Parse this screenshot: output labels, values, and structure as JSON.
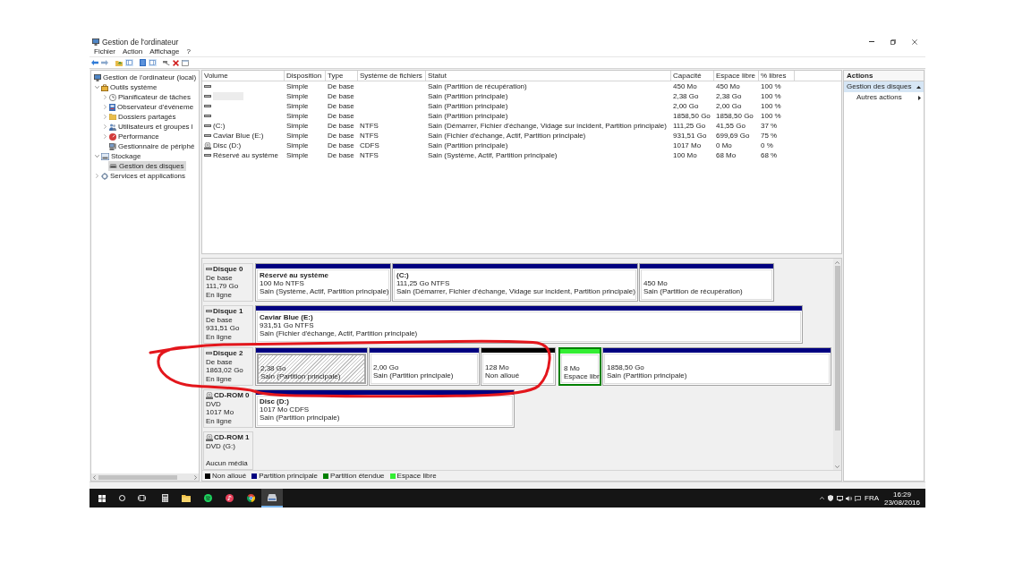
{
  "window": {
    "title": "Gestion de l'ordinateur"
  },
  "menu": [
    "Fichier",
    "Action",
    "Affichage",
    "?"
  ],
  "tree": [
    {
      "label": "Gestion de l'ordinateur (local)",
      "kind": "computer",
      "selected": false,
      "children": [
        {
          "label": "Outils système",
          "kind": "tools",
          "expanded": true,
          "selected": false,
          "children": [
            {
              "label": "Planificateur de tâches",
              "kind": "clock",
              "expanded": false,
              "selected": false
            },
            {
              "label": "Observateur d'événeme",
              "kind": "viewer",
              "expanded": false,
              "selected": false
            },
            {
              "label": "Dossiers partagés",
              "kind": "folder",
              "expanded": false,
              "selected": false
            },
            {
              "label": "Utilisateurs et groupes l",
              "kind": "users",
              "expanded": false,
              "selected": false
            },
            {
              "label": "Performance",
              "kind": "performance",
              "expanded": false,
              "selected": false
            },
            {
              "label": "Gestionnaire de périphé",
              "kind": "devices",
              "selected": false
            }
          ]
        },
        {
          "label": "Stockage",
          "kind": "storage",
          "expanded": true,
          "selected": false,
          "children": [
            {
              "label": "Gestion des disques",
              "kind": "disks",
              "selected": true
            }
          ]
        },
        {
          "label": "Services et applications",
          "kind": "services",
          "expanded": false,
          "selected": false
        }
      ]
    }
  ],
  "volumes": {
    "columns": [
      "Volume",
      "Disposition",
      "Type",
      "Système de fichiers",
      "Statut",
      "Capacité",
      "Espace libre",
      "% libres"
    ],
    "rows": [
      {
        "kind": "disk",
        "redacted": false,
        "layout": "Simple",
        "type": "De base",
        "status": "Sain (Partition de récupération)",
        "capacity": "450 Mo",
        "free": "450 Mo",
        "percent_free": "100 %"
      },
      {
        "kind": "disk",
        "redacted": true,
        "layout": "Simple",
        "type": "De base",
        "status": "Sain (Partition principale)",
        "capacity": "2,38 Go",
        "free": "2,38 Go",
        "percent_free": "100 %"
      },
      {
        "kind": "disk",
        "redacted": false,
        "layout": "Simple",
        "type": "De base",
        "status": "Sain (Partition principale)",
        "capacity": "2,00 Go",
        "free": "2,00 Go",
        "percent_free": "100 %"
      },
      {
        "kind": "disk",
        "redacted": false,
        "layout": "Simple",
        "type": "De base",
        "status": "Sain (Partition principale)",
        "capacity": "1858,50 Go",
        "free": "1858,50 Go",
        "percent_free": "100 %"
      },
      {
        "kind": "disk",
        "redacted": false,
        "volume": "(C:)",
        "layout": "Simple",
        "type": "De base",
        "filesystem": "NTFS",
        "status": "Sain (Démarrer, Fichier d'échange, Vidage sur incident, Partition principale)",
        "capacity": "111,25 Go",
        "free": "41,55 Go",
        "percent_free": "37 %"
      },
      {
        "kind": "disk",
        "redacted": false,
        "volume": "Caviar Blue (E:)",
        "layout": "Simple",
        "type": "De base",
        "filesystem": "NTFS",
        "status": "Sain (Fichier d'échange, Actif, Partition principale)",
        "capacity": "931,51 Go",
        "free": "699,69 Go",
        "percent_free": "75 %"
      },
      {
        "kind": "cd",
        "redacted": false,
        "volume": "Disc (D:)",
        "layout": "Simple",
        "type": "De base",
        "filesystem": "CDFS",
        "status": "Sain (Partition principale)",
        "capacity": "1017 Mo",
        "free": "0 Mo",
        "percent_free": "0 %"
      },
      {
        "kind": "disk",
        "redacted": false,
        "volume": "Réservé au système",
        "layout": "Simple",
        "type": "De base",
        "filesystem": "NTFS",
        "status": "Sain (Système, Actif, Partition principale)",
        "capacity": "100 Mo",
        "free": "68 Mo",
        "percent_free": "68 %"
      }
    ]
  },
  "disks": [
    {
      "kind": "disk",
      "name": "Disque 0",
      "type": "De base",
      "size": "111,79 Go",
      "status": "En ligne",
      "partitions": [
        {
          "kind": "primary",
          "selected": false,
          "name": "Réservé au système",
          "size": "100 Mo NTFS",
          "status": "Sain (Système, Actif, Partition principale)"
        },
        {
          "kind": "primary",
          "selected": false,
          "name": "(C:)",
          "size": "111,25 Go NTFS",
          "status": "Sain (Démarrer, Fichier d'échange, Vidage sur incident, Partition principale)"
        },
        {
          "kind": "primary",
          "selected": false,
          "size": "450 Mo",
          "status": "Sain (Partition de récupération)"
        }
      ]
    },
    {
      "kind": "disk",
      "name": "Disque 1",
      "type": "De base",
      "size": "931,51 Go",
      "status": "En ligne",
      "partitions": [
        {
          "kind": "primary",
          "selected": false,
          "name": "Caviar Blue (E:)",
          "size": "931,51 Go NTFS",
          "status": "Sain (Fichier d'échange, Actif, Partition principale)"
        }
      ]
    },
    {
      "kind": "disk",
      "name": "Disque 2",
      "type": "De base",
      "size": "1863,02 Go",
      "status": "En ligne",
      "partitions": [
        {
          "kind": "primary",
          "selected": true,
          "size": "2,38 Go",
          "status": "Sain (Partition principale)"
        },
        {
          "kind": "primary",
          "selected": false,
          "size": "2,00 Go",
          "status": "Sain (Partition principale)"
        },
        {
          "kind": "unallocated",
          "selected": false,
          "size": "128 Mo",
          "status": "Non alloué"
        },
        {
          "kind": "free",
          "selected": false,
          "size": "8 Mo",
          "status": "Espace libr"
        },
        {
          "kind": "primary",
          "selected": false,
          "size": "1858,50 Go",
          "status": "Sain (Partition principale)"
        }
      ]
    },
    {
      "kind": "cdrom",
      "name": "CD-ROM 0",
      "type": "DVD",
      "size": "1017 Mo",
      "status": "En ligne",
      "partitions": [
        {
          "kind": "primary",
          "selected": false,
          "name": "Disc (D:)",
          "size": "1017 Mo CDFS",
          "status": "Sain (Partition principale)"
        }
      ]
    },
    {
      "kind": "cdrom",
      "name": "CD-ROM 1",
      "type": "DVD (G:)",
      "status": "Aucun média"
    }
  ],
  "legend": [
    {
      "label": "Non alloué",
      "color": "#000000"
    },
    {
      "label": "Partition principale",
      "color": "#000080"
    },
    {
      "label": "Partition étendue",
      "color": "#008000"
    },
    {
      "label": "Espace libre",
      "color": "#33ee33"
    }
  ],
  "actions": {
    "title": "Actions",
    "sections": [
      {
        "label": "Gestion des disques",
        "expanded": true,
        "items": [
          {
            "label": "Autres actions"
          }
        ]
      }
    ]
  },
  "taskbar": {
    "apps": [
      {
        "kind": "calculator",
        "selected": false
      },
      {
        "kind": "folder",
        "selected": false
      },
      {
        "kind": "music-streaming",
        "selected": false
      },
      {
        "kind": "music-player",
        "selected": false
      },
      {
        "kind": "browser",
        "selected": false
      },
      {
        "kind": "disk-tool",
        "selected": true
      }
    ],
    "language": "FRA",
    "time": "16:29",
    "date": "23/08/2016"
  }
}
